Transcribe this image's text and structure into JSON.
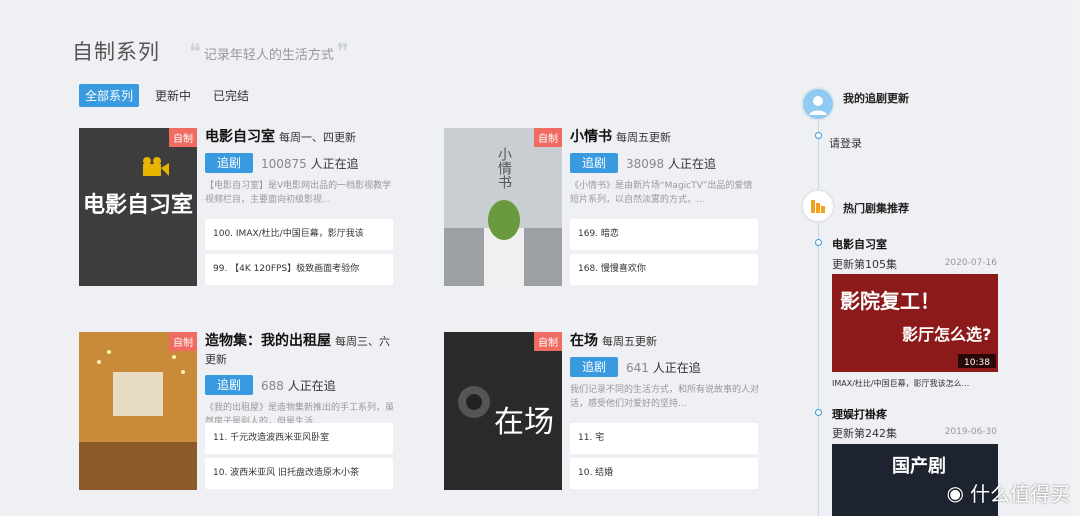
{
  "header": {
    "title": "自制系列",
    "subtitle": "记录年轻人的生活方式"
  },
  "filters": [
    "全部系列",
    "更新中",
    "已完结"
  ],
  "cards": [
    {
      "title": "电影自习室",
      "schedule": "每周一、四更新",
      "follow_label": "追剧",
      "followers": "100875",
      "followers_suffix": "人正在追",
      "badge": "自制",
      "desc": "【电影自习室】是V电影网出品的一档影视教学视频栏目，主要面向初级影视...",
      "episodes": [
        "100. IMAX/杜比/中国巨幕，影厅我该",
        "99. 【4K 120FPS】极致画面考验你"
      ],
      "cover_text": "电影自习室"
    },
    {
      "title": "小情书",
      "schedule": "每周五更新",
      "follow_label": "追剧",
      "followers": "38098",
      "followers_suffix": "人正在追",
      "badge": "自制",
      "desc": "《小情书》是由新片场“MagicTV”出品的爱情短片系列，以自然淡雾的方式，...",
      "episodes": [
        "169. 暗恋",
        "168. 慢慢喜欢你"
      ],
      "cover_text": "小情书"
    },
    {
      "title": "造物集：我的出租屋",
      "schedule": "每周三、六更新",
      "follow_label": "追剧",
      "followers": "688",
      "followers_suffix": "人正在追",
      "badge": "自制",
      "desc": "《我的出租屋》是造物集新推出的手工系列，虽然房子是别人的，但是生活...",
      "episodes": [
        "11. 千元改造波西米亚风卧室",
        "10. 波西米亚风 旧托盘改造原木小茶"
      ],
      "cover_text": ""
    },
    {
      "title": "在场",
      "schedule": "每周五更新",
      "follow_label": "追剧",
      "followers": "641",
      "followers_suffix": "人正在追",
      "badge": "自制",
      "desc": "我们记录不同的生活方式，和所有说故事的人对话，感受他们对爱好的坚持...",
      "episodes": [
        "11. 宅",
        "10. 结婚"
      ],
      "cover_text": "在场"
    }
  ],
  "sidebar": {
    "my_updates_title": "我的追剧更新",
    "login": "请登录",
    "hot_title": "热门剧集推荐",
    "hot": [
      {
        "name": "电影自习室",
        "ep": "更新第105集",
        "date": "2020-07-16",
        "caption": "IMAX/杜比/中国巨幕，影厅我该怎么...",
        "thumb_text": "影院复工！",
        "thumb_text2": "影厅怎么选?",
        "thumb_time": "10:38"
      },
      {
        "name": "理娱打褂疼",
        "ep": "更新第242集",
        "date": "2019-06-30",
        "thumb_text": "国产剧"
      }
    ]
  },
  "watermark": "什么值得买",
  "colors": {
    "accent": "#3a9ae0",
    "badge": "#f06b61"
  }
}
